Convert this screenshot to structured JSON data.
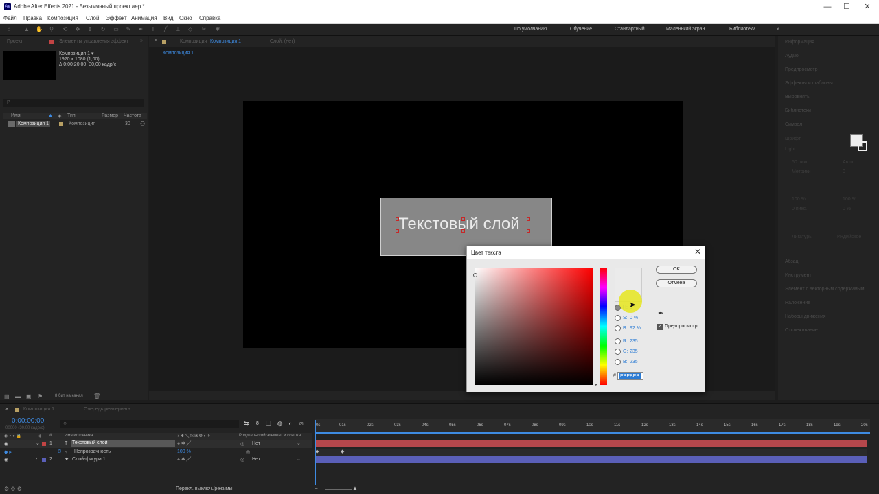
{
  "window": {
    "title": "Adobe After Effects 2021 - Безымянный проект.aep *",
    "logo": "Ae",
    "minimize": "—",
    "maximize": "☐",
    "close": "✕"
  },
  "menu": [
    "Файл",
    "Правка",
    "Композиция",
    "Слой",
    "Эффект",
    "Анимация",
    "Вид",
    "Окно",
    "Справка"
  ],
  "workspaces": {
    "items": [
      "По умолчанию",
      "Обучение",
      "Стандартный",
      "Маленький экран",
      "Библиотеки"
    ],
    "active_index": 0,
    "more": "»"
  },
  "project_panel": {
    "tab_project": "Проект",
    "tab_effects": "Элементы управления эффект",
    "comp_name": "Композиция 1 ▾",
    "comp_size": "1920 x 1080 (1,00)",
    "comp_duration": "Δ 0:00:20:00, 30,00 кадр/с",
    "search_placeholder": "Р",
    "columns": [
      "Имя",
      "Тип",
      "Размер",
      "Частота"
    ],
    "items": [
      {
        "name": "Композиция 1",
        "type": "Композиция",
        "fps": "30"
      }
    ],
    "footer": "8 бит на канал"
  },
  "viewer": {
    "tab_prefix": "Композиция",
    "tab_name": "Композиция 1",
    "tab_layer": "Слой: (нет)",
    "breadcrumb": "Композиция 1",
    "text_layer": "Текстовый слой"
  },
  "right_panel": {
    "items": [
      "Информация",
      "Аудио",
      "Предпросмотр",
      "Эффекты и шаблоны",
      "Выровнять",
      "Библиотеки",
      "Символ",
      "Абзац",
      "Инструмент",
      "Элемент с векторным содержимым",
      "Наложение",
      "Наборы движения",
      "Отслеживание"
    ],
    "char_fields": [
      "Шрифт",
      "Light",
      "50 пикс.",
      "Авто",
      "Метрики",
      "0",
      "100 %",
      "100 %",
      "0 пикс.",
      "0 %"
    ],
    "checkbox_ligatures": "Лигатуры",
    "checkbox_hindi": "Индийское"
  },
  "color_dialog": {
    "title": "Цвет текста",
    "close": "✕",
    "ok": "OK",
    "cancel": "Отмена",
    "preview_label": "Предпросмотр",
    "hsb": {
      "h_label": "H:",
      "h_value": "0 °",
      "s_label": "S:",
      "s_value": "0 %",
      "b_label": "B:",
      "b_value": "92 %"
    },
    "rgb": {
      "r_label": "R:",
      "r_value": "235",
      "g_label": "G:",
      "g_value": "235",
      "b_label": "B:",
      "b_value": "235"
    },
    "hex": "EBEBEB",
    "current_color": "#ebebeb"
  },
  "timeline": {
    "tab_comp": "Композиция 1",
    "tab_queue": "Очередь рендеринга",
    "timecode": "0:00:00:00",
    "fps_note": "00000 (30.00 кадр/с)",
    "columns": [
      "Имя источника",
      "Родительский элемент и ссылка"
    ],
    "layers": [
      {
        "index": "1",
        "type_icon": "T",
        "name": "Текстовый слой",
        "parent": "Нет",
        "color": "#c24444"
      },
      {
        "index": "",
        "type_icon": "⏱",
        "name": "Непрозрачность",
        "value": "100 %",
        "color": ""
      },
      {
        "index": "2",
        "type_icon": "★",
        "name": "Слой-фигура 1",
        "parent": "Нет",
        "color": "#5a5fb8"
      }
    ],
    "ruler": [
      "0s",
      "01s",
      "02s",
      "03s",
      "04s",
      "05s",
      "06s",
      "07s",
      "08s",
      "09s",
      "10s",
      "11s",
      "12s",
      "13s",
      "14s",
      "15s",
      "16s",
      "17s",
      "18s",
      "19s",
      "20s"
    ],
    "status": "Перекл. выключ./режимы"
  }
}
